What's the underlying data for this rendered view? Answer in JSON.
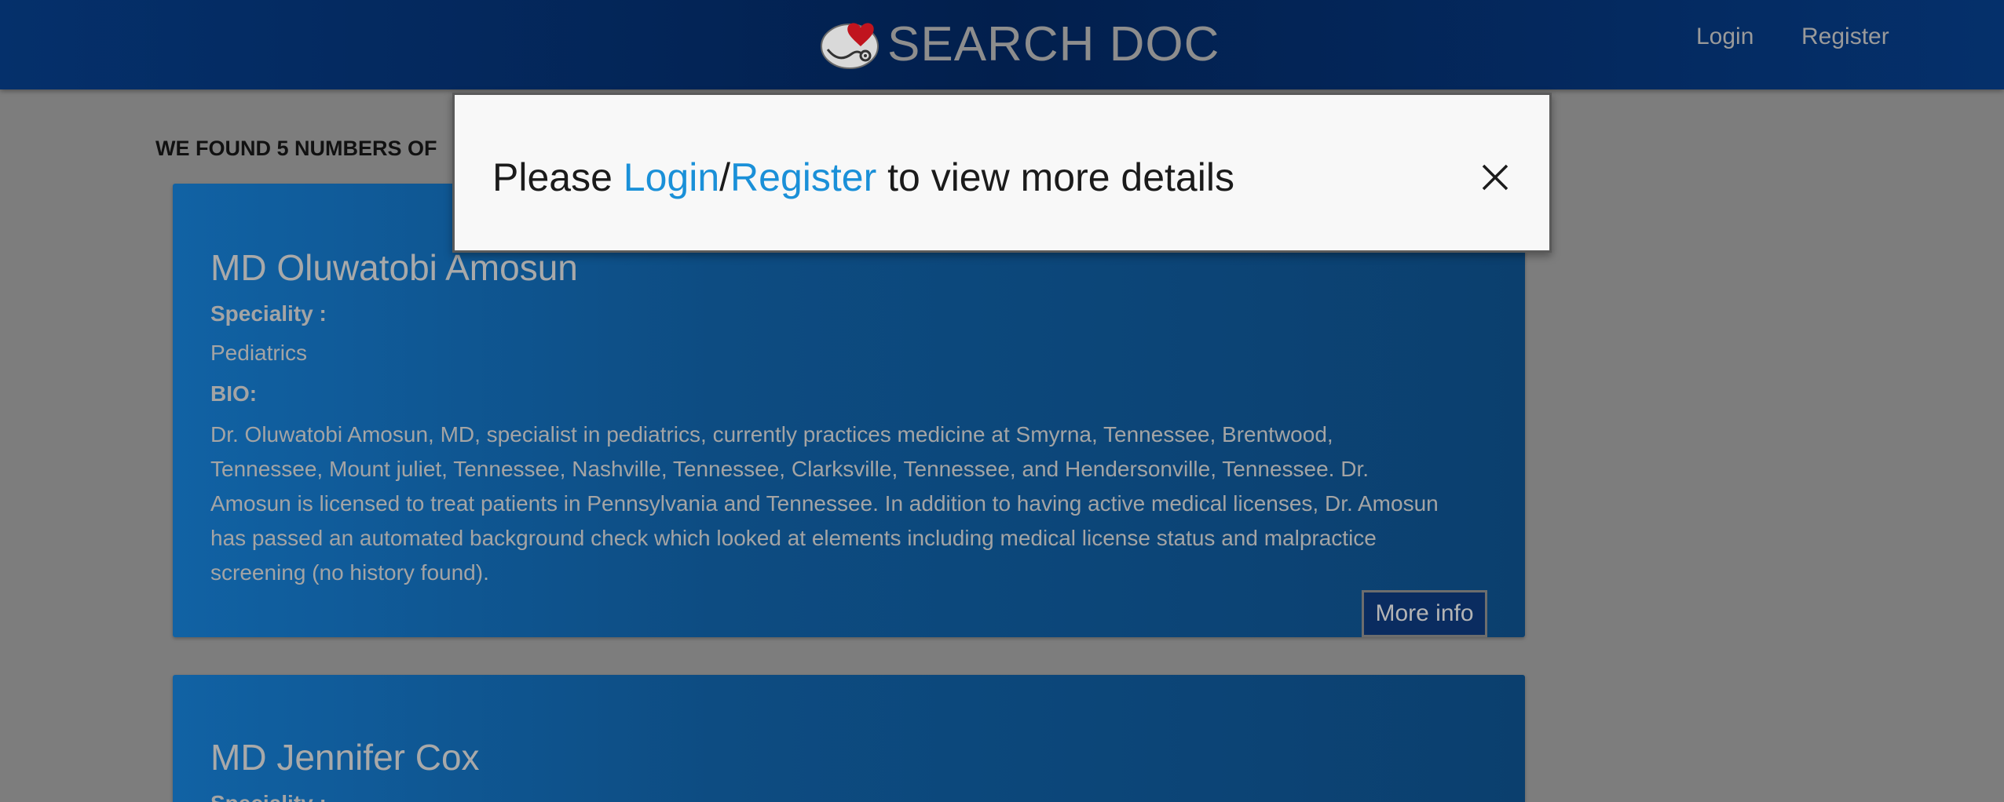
{
  "header": {
    "brand": "SEARCH DOC",
    "nav": {
      "login": "Login",
      "register": "Register"
    }
  },
  "results": {
    "heading": "WE FOUND 5 NUMBERS OF"
  },
  "doctors": [
    {
      "name": "MD Oluwatobi Amosun",
      "speciality_label": "Speciality :",
      "speciality": "Pediatrics",
      "bio_label": "BIO:",
      "bio": "Dr. Oluwatobi Amosun, MD, specialist in pediatrics, currently practices medicine at Smyrna, Tennessee, Brentwood, Tennessee, Mount juliet, Tennessee, Nashville, Tennessee, Clarksville, Tennessee, and Hendersonville, Tennessee. Dr. Amosun is licensed to treat patients in Pennsylvania and Tennessee. In addition to having active medical licenses, Dr. Amosun has passed an automated background check which looked at elements including medical license status and malpractice screening (no history found).",
      "more_label": "More info"
    },
    {
      "name": "MD Jennifer Cox",
      "speciality_label": "Speciality :"
    }
  ],
  "modal": {
    "prefix": "Please ",
    "login": "Login",
    "separator": "/",
    "register": "Register",
    "suffix": " to view more details",
    "close_icon": "close-icon"
  },
  "colors": {
    "header": "#021f4d",
    "card": "#0d4c82",
    "link": "#1a90d8",
    "overlay": "#7d7d7d"
  }
}
